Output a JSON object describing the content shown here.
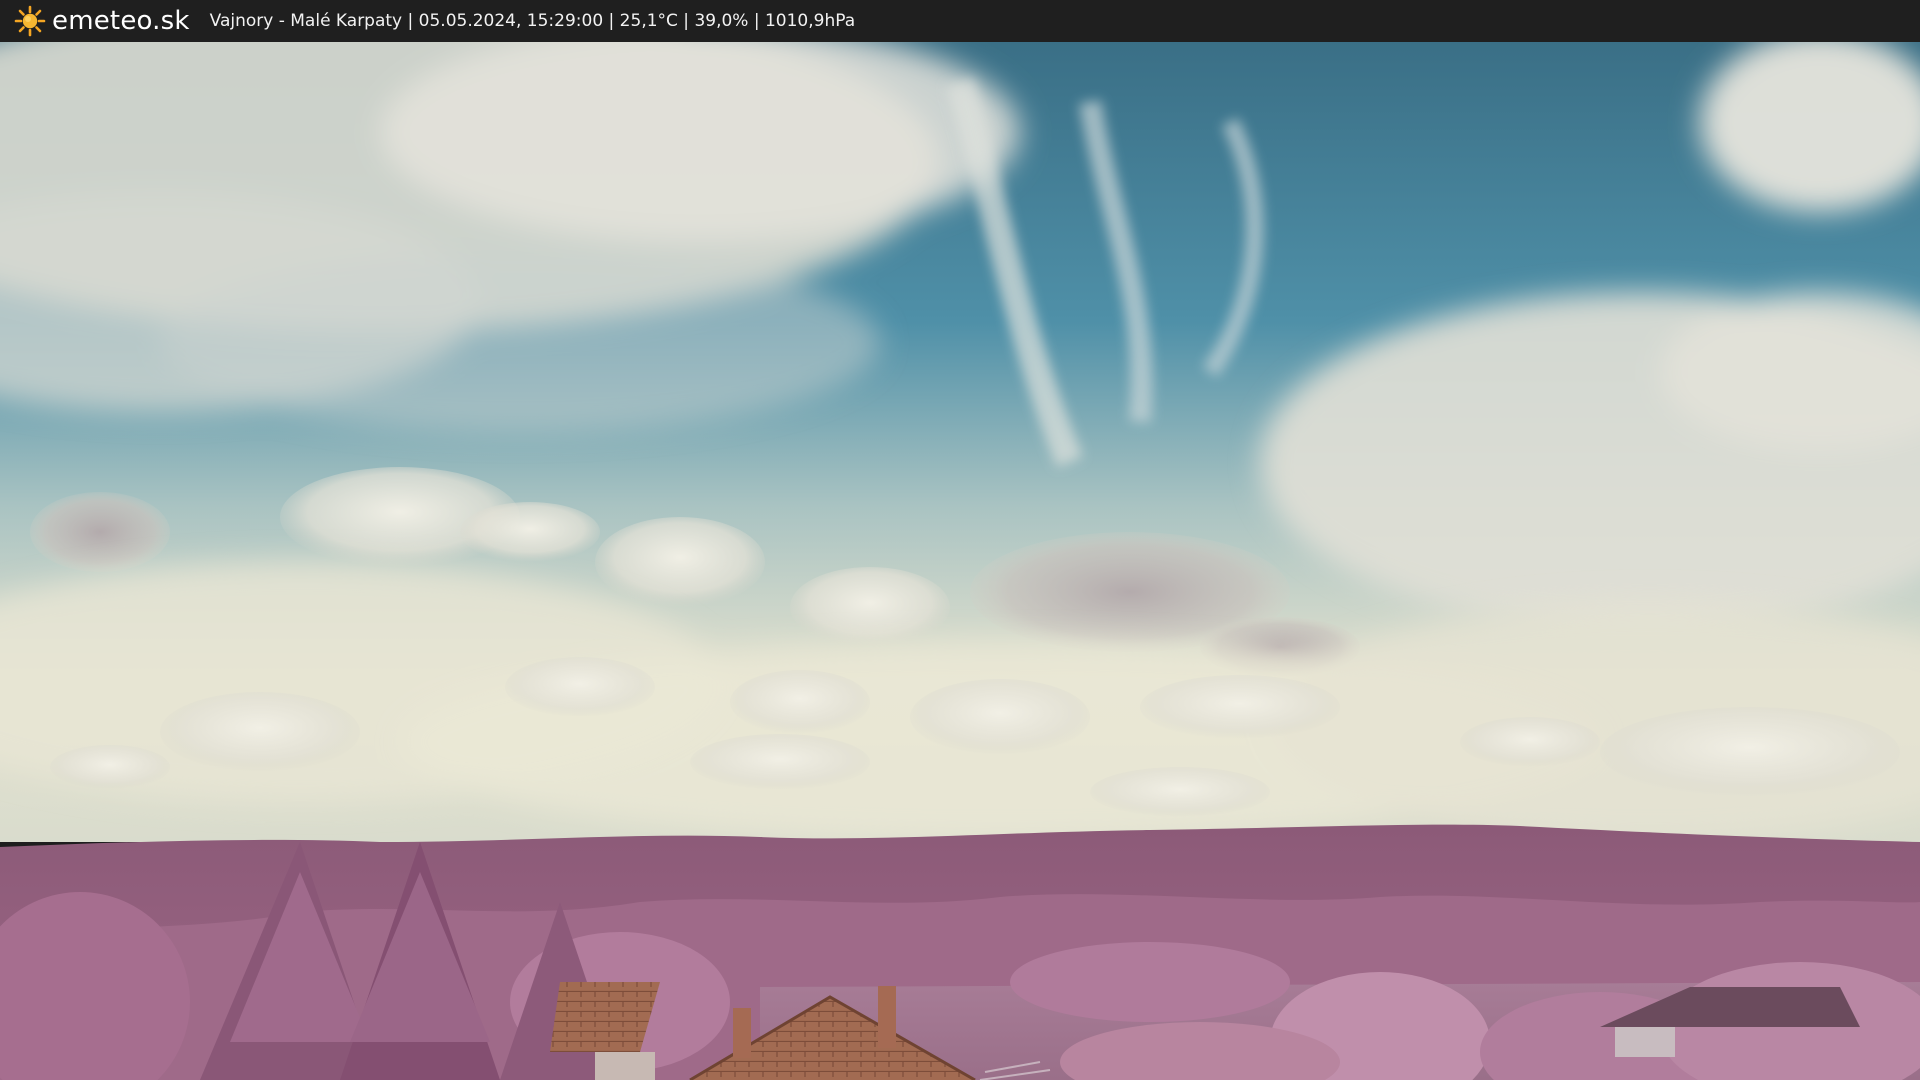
{
  "header": {
    "brand": "emeteo.sk",
    "caption": "Vajnory - Malé Karpaty | 05.05.2024, 15:29:00 | 25,1°C | 39,0% | 1010,9hPa",
    "brand_icon": "sun-icon"
  },
  "colors": {
    "bar": "#1f1f1f",
    "sun": "#f5a623",
    "sky_top": "#3f7d97",
    "sky_horizon": "#e7e4d2",
    "hills": "#8f5f7c",
    "foliage": "#b07a9b",
    "roof": "#a0694f"
  }
}
